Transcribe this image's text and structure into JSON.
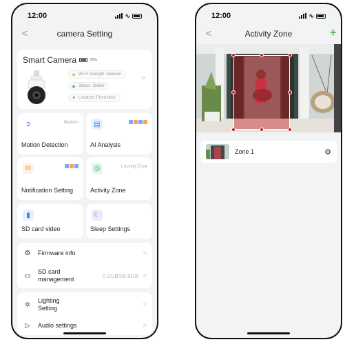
{
  "left_screen": {
    "status_time": "12:00",
    "nav_title": "camera Setting",
    "back_glyph": "<",
    "camera": {
      "name": "Smart Camera",
      "battery_pct": "95%",
      "wifi": "Wi-Fi strength: Medium",
      "status": "Status: Online",
      "location": "Location: Front door"
    },
    "tiles": {
      "motion": {
        "label": "Motion Detection",
        "meta": "Medium"
      },
      "ai": {
        "label": "AI Analysis"
      },
      "notification": {
        "label": "Notification Setting"
      },
      "activity": {
        "label": "Activity Zone",
        "meta": "1 Activity Zone"
      },
      "sd": {
        "label": "SD card video"
      },
      "sleep": {
        "label": "Sleep Settings"
      }
    },
    "rows": {
      "firmware": {
        "label": "Firmware info"
      },
      "sd_manage": {
        "label": "SD card management",
        "value": "0.2GB/58.6GB"
      },
      "lighting": {
        "label": "Lighting Setting"
      },
      "audio": {
        "label": "Audio settings"
      }
    },
    "chevron": ">"
  },
  "right_screen": {
    "status_time": "12:00",
    "nav_title": "Activity Zone",
    "back_glyph": "<",
    "add_glyph": "+",
    "zone": {
      "name": "Zone 1"
    }
  },
  "icons": {
    "motion": "running-person-icon",
    "ai": "chart-icon",
    "notification": "envelope-icon",
    "activity": "target-icon",
    "sd": "sd-card-icon",
    "sleep": "moon-icon",
    "firmware": "chip-icon",
    "sd_manage": "sd-card-outline-icon",
    "lighting": "bulb-icon",
    "audio": "speaker-icon"
  },
  "colors": {
    "accent_blue": "#3c7df0",
    "zone_red": "#d01a1a",
    "add_green": "#3a9a3a"
  }
}
